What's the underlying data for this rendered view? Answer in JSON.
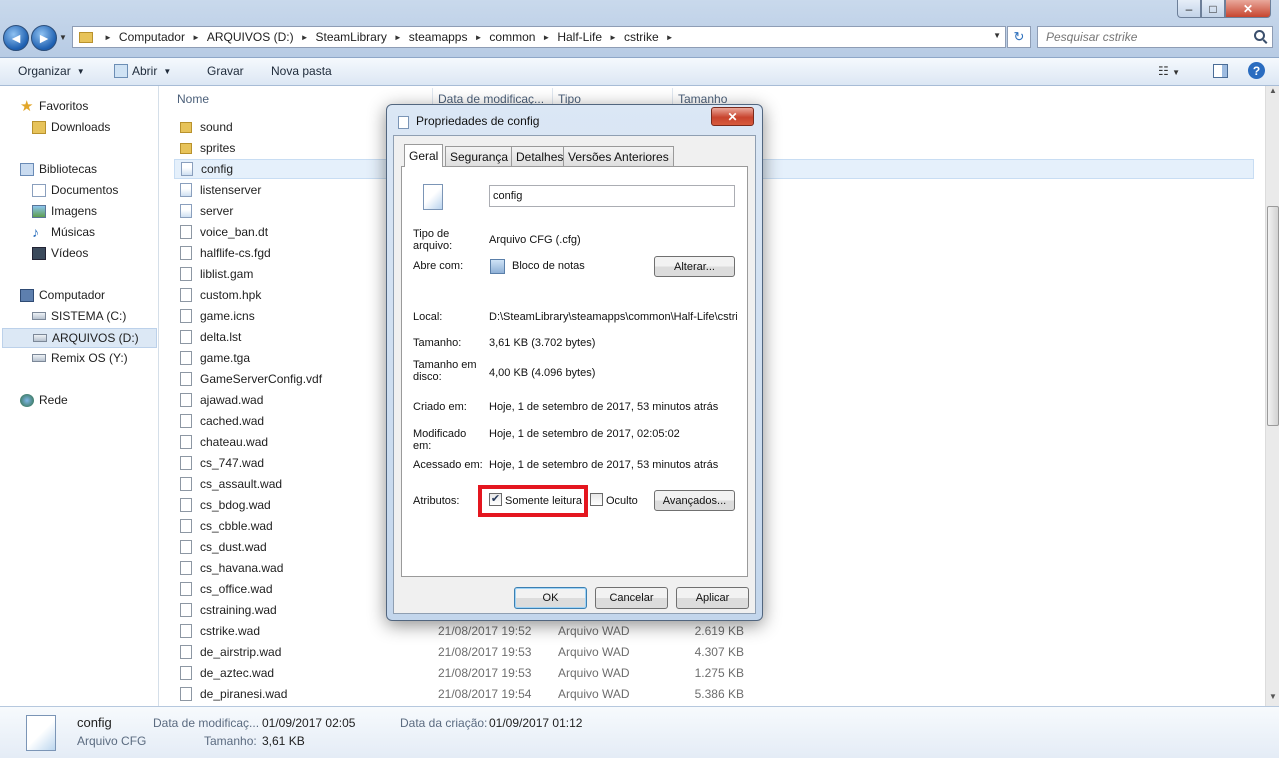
{
  "window": {
    "min_label": "–",
    "max_label": "□",
    "close_label": "✕"
  },
  "nav": {
    "back_label": "◄",
    "forward_label": "►",
    "refresh_label": "↻"
  },
  "address": {
    "crumbs": [
      "Computador",
      "ARQUIVOS (D:)",
      "SteamLibrary",
      "steamapps",
      "common",
      "Half-Life",
      "cstrike"
    ]
  },
  "search": {
    "placeholder": "Pesquisar cstrike"
  },
  "toolbar": {
    "organize": "Organizar",
    "open": "Abrir",
    "burn": "Gravar",
    "new_folder": "Nova pasta",
    "view_label": "☷",
    "help_label": "?"
  },
  "sidebar": {
    "favorites": "Favoritos",
    "downloads": "Downloads",
    "libraries": "Bibliotecas",
    "documents": "Documentos",
    "images": "Imagens",
    "music": "Músicas",
    "videos": "Vídeos",
    "computer": "Computador",
    "drive_c": "SISTEMA (C:)",
    "drive_d": "ARQUIVOS (D:)",
    "drive_y": "Remix OS (Y:)",
    "network": "Rede"
  },
  "columns": {
    "name": "Nome",
    "date": "Data de modificaç...",
    "type": "Tipo",
    "size": "Tamanho"
  },
  "files": [
    {
      "name": "sound",
      "icon": "folder-icon",
      "date": "",
      "type": "",
      "size": ""
    },
    {
      "name": "sprites",
      "icon": "folder-icon",
      "date": "",
      "type": "",
      "size": ""
    },
    {
      "name": "config",
      "icon": "cfg-file-icon",
      "date": "",
      "type": "",
      "size": ""
    },
    {
      "name": "listenserver",
      "icon": "cfg-file-icon",
      "date": "",
      "type": "",
      "size": ""
    },
    {
      "name": "server",
      "icon": "cfg-file-icon",
      "date": "",
      "type": "",
      "size": ""
    },
    {
      "name": "voice_ban.dt",
      "icon": "file-icon",
      "date": "",
      "type": "",
      "size": ""
    },
    {
      "name": "halflife-cs.fgd",
      "icon": "file-icon",
      "date": "",
      "type": "",
      "size": ""
    },
    {
      "name": "liblist.gam",
      "icon": "file-icon",
      "date": "",
      "type": "",
      "size": ""
    },
    {
      "name": "custom.hpk",
      "icon": "file-icon",
      "date": "",
      "type": "",
      "size": ""
    },
    {
      "name": "game.icns",
      "icon": "file-icon",
      "date": "",
      "type": "",
      "size": ""
    },
    {
      "name": "delta.lst",
      "icon": "file-icon",
      "date": "",
      "type": "",
      "size": ""
    },
    {
      "name": "game.tga",
      "icon": "file-icon",
      "date": "",
      "type": "",
      "size": ""
    },
    {
      "name": "GameServerConfig.vdf",
      "icon": "file-icon",
      "date": "",
      "type": "",
      "size": ""
    },
    {
      "name": "ajawad.wad",
      "icon": "file-icon",
      "date": "",
      "type": "",
      "size": ""
    },
    {
      "name": "cached.wad",
      "icon": "file-icon",
      "date": "",
      "type": "",
      "size": ""
    },
    {
      "name": "chateau.wad",
      "icon": "file-icon",
      "date": "",
      "type": "",
      "size": ""
    },
    {
      "name": "cs_747.wad",
      "icon": "file-icon",
      "date": "",
      "type": "",
      "size": ""
    },
    {
      "name": "cs_assault.wad",
      "icon": "file-icon",
      "date": "",
      "type": "",
      "size": ""
    },
    {
      "name": "cs_bdog.wad",
      "icon": "file-icon",
      "date": "",
      "type": "",
      "size": ""
    },
    {
      "name": "cs_cbble.wad",
      "icon": "file-icon",
      "date": "",
      "type": "",
      "size": ""
    },
    {
      "name": "cs_dust.wad",
      "icon": "file-icon",
      "date": "",
      "type": "",
      "size": ""
    },
    {
      "name": "cs_havana.wad",
      "icon": "file-icon",
      "date": "",
      "type": "",
      "size": ""
    },
    {
      "name": "cs_office.wad",
      "icon": "file-icon",
      "date": "",
      "type": "",
      "size": ""
    },
    {
      "name": "cstraining.wad",
      "icon": "file-icon",
      "date": "",
      "type": "",
      "size": ""
    },
    {
      "name": "cstrike.wad",
      "icon": "file-icon",
      "date": "21/08/2017 19:52",
      "type": "Arquivo WAD",
      "size": "2.619 KB"
    },
    {
      "name": "de_airstrip.wad",
      "icon": "file-icon",
      "date": "21/08/2017 19:53",
      "type": "Arquivo WAD",
      "size": "4.307 KB"
    },
    {
      "name": "de_aztec.wad",
      "icon": "file-icon",
      "date": "21/08/2017 19:53",
      "type": "Arquivo WAD",
      "size": "1.275 KB"
    },
    {
      "name": "de_piranesi.wad",
      "icon": "file-icon",
      "date": "21/08/2017 19:54",
      "type": "Arquivo WAD",
      "size": "5.386 KB"
    }
  ],
  "details_pane": {
    "name": "config",
    "type": "Arquivo CFG",
    "modified_label": "Data de modificaç...",
    "modified_value": "01/09/2017 02:05",
    "size_label": "Tamanho:",
    "size_value": "3,61 KB",
    "created_label": "Data da criação:",
    "created_value": "01/09/2017 01:12"
  },
  "dialog": {
    "title": "Propriedades de config",
    "close_label": "✕",
    "tabs": [
      "Geral",
      "Segurança",
      "Detalhes",
      "Versões Anteriores"
    ],
    "filename": "config",
    "file_type_label": "Tipo de arquivo:",
    "file_type_value": "Arquivo CFG (.cfg)",
    "opens_with_label": "Abre com:",
    "opens_with_value": "Bloco de notas",
    "change_button": "Alterar...",
    "location_label": "Local:",
    "location_value": "D:\\SteamLibrary\\steamapps\\common\\Half-Life\\cstri",
    "size_label": "Tamanho:",
    "size_value": "3,61 KB (3.702 bytes)",
    "disk_size_label": "Tamanho em disco:",
    "disk_size_value": "4,00 KB (4.096 bytes)",
    "created_label": "Criado em:",
    "created_value": "Hoje, 1 de setembro de 2017, 53 minutos atrás",
    "modified_label": "Modificado em:",
    "modified_value": "Hoje, 1 de setembro de 2017, 02:05:02",
    "accessed_label": "Acessado em:",
    "accessed_value": "Hoje, 1 de setembro de 2017, 53 minutos atrás",
    "attributes_label": "Atributos:",
    "readonly_label": "Somente leitura",
    "readonly_checked": true,
    "hidden_label": "Oculto",
    "hidden_checked": false,
    "advanced_button": "Avançados...",
    "ok_button": "OK",
    "cancel_button": "Cancelar",
    "apply_button": "Aplicar"
  }
}
